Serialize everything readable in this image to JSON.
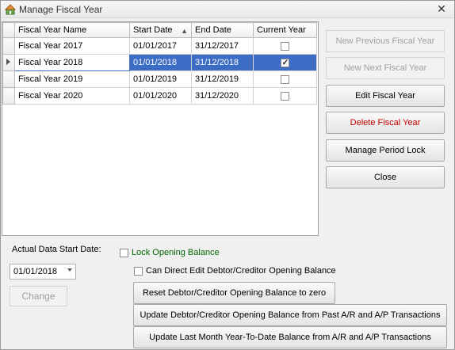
{
  "window": {
    "title": "Manage Fiscal Year",
    "close_glyph": "✕"
  },
  "grid": {
    "columns": [
      "Fiscal Year Name",
      "Start Date",
      "End Date",
      "Current Year"
    ],
    "sorted_column": "Start Date",
    "rows": [
      {
        "name": "Fiscal Year 2017",
        "start": "01/01/2017",
        "end": "31/12/2017",
        "current": false
      },
      {
        "name": "Fiscal Year 2018",
        "start": "01/01/2018",
        "end": "31/12/2018",
        "current": true,
        "selected": true
      },
      {
        "name": "Fiscal Year 2019",
        "start": "01/01/2019",
        "end": "31/12/2019",
        "current": false
      },
      {
        "name": "Fiscal Year 2020",
        "start": "01/01/2020",
        "end": "31/12/2020",
        "current": false
      }
    ]
  },
  "buttons": {
    "new_previous": "New Previous Fiscal Year",
    "new_next": "New Next Fiscal Year",
    "edit": "Edit Fiscal Year",
    "delete": "Delete Fiscal Year",
    "period_lock": "Manage Period Lock",
    "close": "Close"
  },
  "bottom": {
    "start_date_label": "Actual Data Start Date:",
    "start_date_value": "01/01/2018",
    "change_button": "Change",
    "lock_opening_label": "Lock Opening Balance",
    "can_direct_edit_label": "Can Direct Edit Debtor/Creditor Opening Balance",
    "reset_button": "Reset Debtor/Creditor Opening Balance to zero",
    "update_opening_button": "Update Debtor/Creditor Opening Balance from Past A/R and A/P Transactions",
    "update_ytd_button": "Update Last Month Year-To-Date Balance from A/R and A/P Transactions"
  },
  "colors": {
    "selection": "#3c6cc3",
    "danger_text": "#c00000",
    "lock_label": "#006400"
  }
}
